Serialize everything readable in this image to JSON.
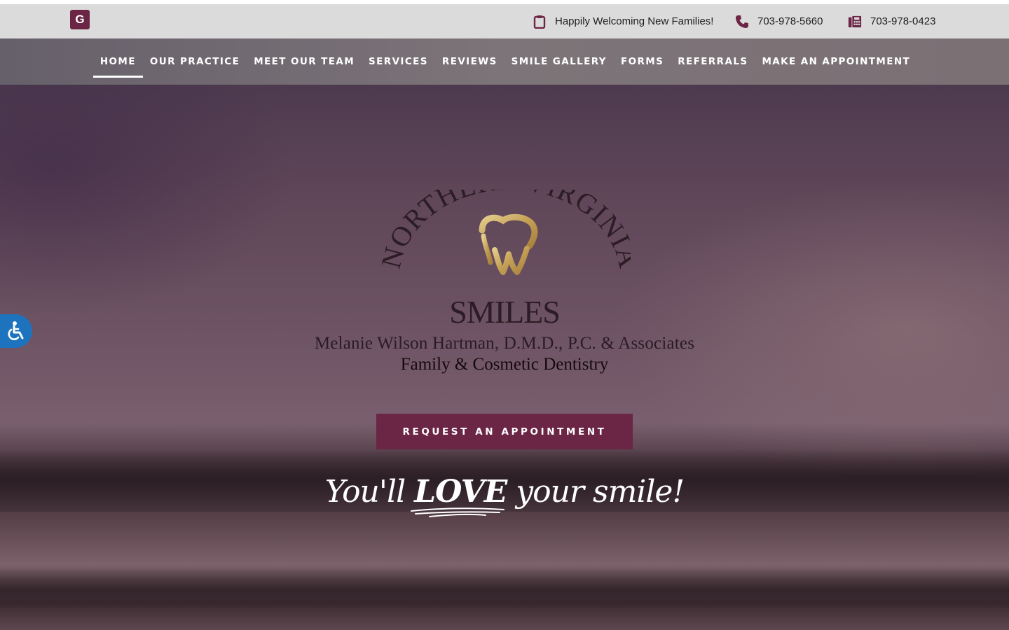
{
  "topbar": {
    "google_badge": "G",
    "welcome_text": "Happily Welcoming New Families!",
    "phone": "703-978-5660",
    "fax": "703-978-0423",
    "icons": [
      "clipboard-icon",
      "phone-icon",
      "fax-icon"
    ]
  },
  "nav": {
    "items": [
      {
        "label": "HOME",
        "active": true
      },
      {
        "label": "OUR PRACTICE"
      },
      {
        "label": "MEET OUR TEAM"
      },
      {
        "label": "SERVICES"
      },
      {
        "label": "REVIEWS"
      },
      {
        "label": "SMILE GALLERY"
      },
      {
        "label": "FORMS"
      },
      {
        "label": "REFERRALS"
      },
      {
        "label": "MAKE AN APPOINTMENT"
      }
    ]
  },
  "hero": {
    "logo_arc": "NORTHERN VIRGINIA",
    "logo_word": "SMILES",
    "line1": "Melanie Wilson Hartman, D.M.D., P.C. & Associates",
    "line2": "Family & Cosmetic Dentistry",
    "cta_label": "REQUEST AN APPOINTMENT",
    "tagline_pre": "You'll ",
    "tagline_love": "LOVE",
    "tagline_post": " your smile!"
  },
  "colors": {
    "brand": "#6b2545",
    "gold": "#c9a65a",
    "accessibility": "#1e73be"
  }
}
